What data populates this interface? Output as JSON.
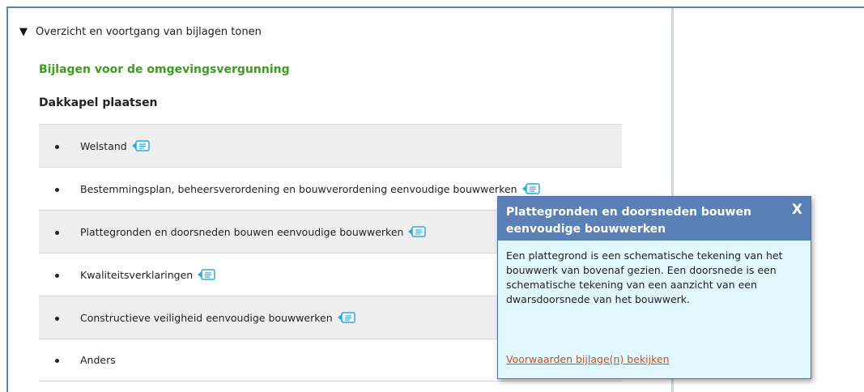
{
  "toggle": {
    "label": "Overzicht en voortgang van bijlagen tonen",
    "icon": "triangle-down-icon"
  },
  "section_title": "Bijlagen voor de omgevingsvergunning",
  "group_title": "Dakkapel plaatsen",
  "items": [
    {
      "label": "Welstand"
    },
    {
      "label": "Bestemmingsplan, beheersverordening en bouwverordening eenvoudige bouwwerken"
    },
    {
      "label": "Plattegronden en doorsneden bouwen eenvoudige bouwwerken"
    },
    {
      "label": "Kwaliteitsverklaringen"
    },
    {
      "label": "Constructieve veiligheid eenvoudige bouwwerken"
    },
    {
      "label": "Anders"
    }
  ],
  "popup": {
    "title": "Plattegronden en doorsneden bouwen eenvoudige bouwwerken",
    "close_label": "X",
    "body": "Een plattegrond is een schematische tekening van het bouwwerk van bovenaf gezien. Een doorsnede is een schematische tekening van een aanzicht van een dwarsdoorsnede van het bouwwerk.",
    "link": "Voorwaarden bijlage(n) bekijken"
  },
  "colors": {
    "accent_green": "#3d9b1f",
    "popup_header": "#5a80b5",
    "popup_bg": "#e2f8ff",
    "link": "#c8501a",
    "icon_blue": "#29a9e6"
  }
}
